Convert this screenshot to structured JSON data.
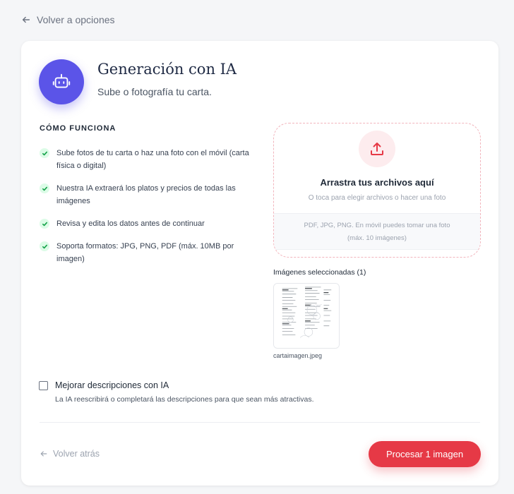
{
  "nav": {
    "back_label": "Volver a opciones"
  },
  "header": {
    "title": "Generación con IA",
    "subtitle": "Sube o fotografía tu carta."
  },
  "how_it_works": {
    "heading": "CÓMO FUNCIONA",
    "steps": [
      "Sube fotos de tu carta o haz una foto con el móvil (carta física o digital)",
      "Nuestra IA extraerá los platos y precios de todas las imágenes",
      "Revisa y edita los datos antes de continuar",
      "Soporta formatos: JPG, PNG, PDF (máx. 10MB por imagen)"
    ]
  },
  "upload": {
    "title": "Arrastra tus archivos aquí",
    "subtitle": "O toca para elegir archivos o hacer una foto",
    "formats_line1": "PDF, JPG, PNG. En móvil puedes tomar una foto",
    "formats_line2": "(máx. 10 imágenes)"
  },
  "selected": {
    "label": "Imágenes seleccionadas (1)",
    "files": [
      {
        "name": "cartaimagen.jpeg"
      }
    ]
  },
  "improve": {
    "label": "Mejorar descripciones con IA",
    "description": "La IA reescribirá o completará las descripciones para que sean más atractivas.",
    "checked": false
  },
  "footer": {
    "back_label": "Volver atrás",
    "process_label": "Procesar 1 imagen"
  },
  "colors": {
    "accent": "#5b54e8",
    "primary_button": "#e63946",
    "check": "#16a34a",
    "background": "#f5f6f8"
  },
  "icons": {
    "back": "arrow-left-icon",
    "avatar": "robot-icon",
    "check": "check-icon",
    "upload": "upload-icon"
  }
}
